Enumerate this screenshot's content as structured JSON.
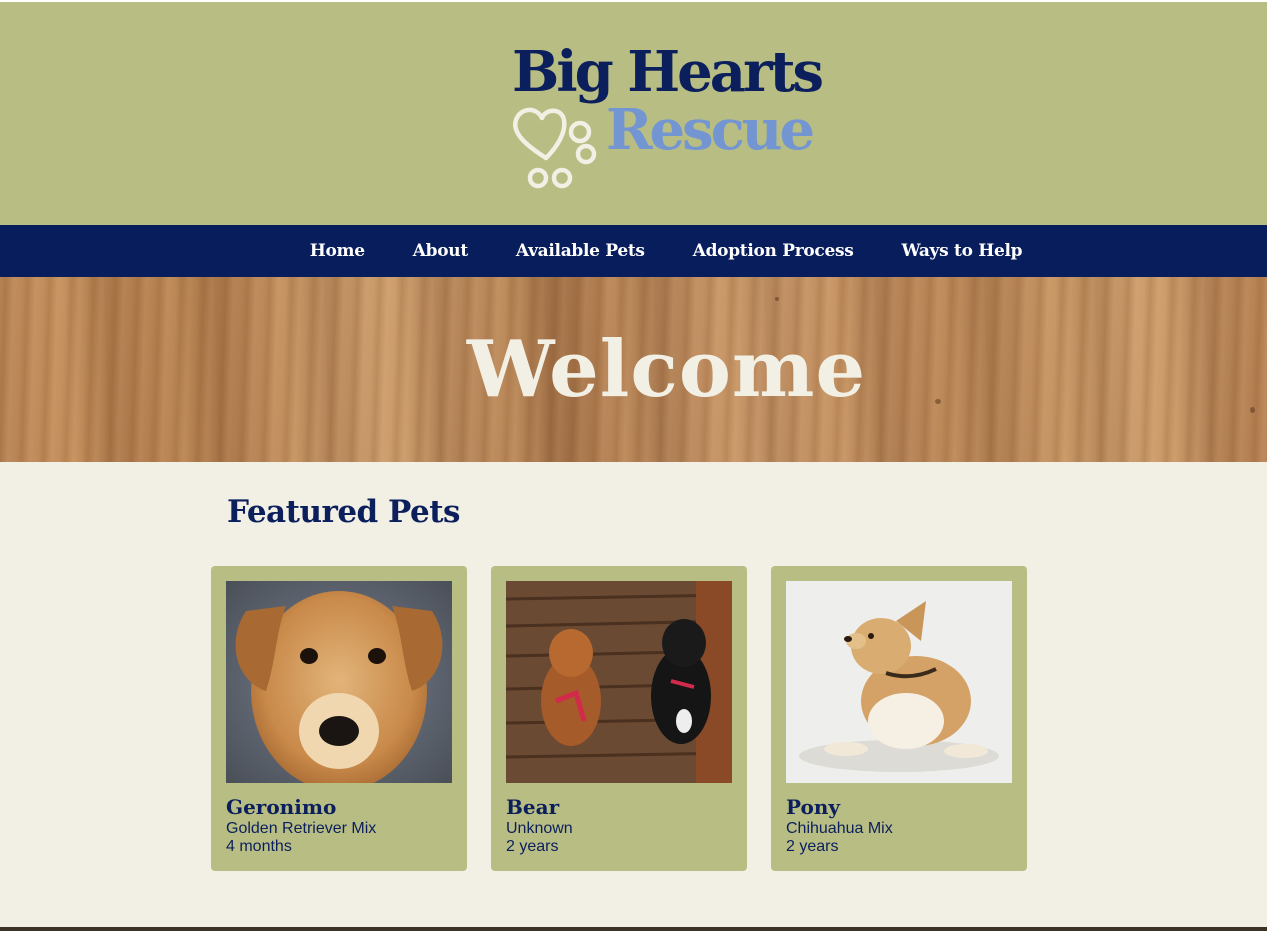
{
  "brand": {
    "line1": "Big Hearts",
    "line2": "Rescue"
  },
  "nav": {
    "items": [
      "Home",
      "About",
      "Available Pets",
      "Adoption Process",
      "Ways to Help"
    ]
  },
  "hero": {
    "title": "Welcome"
  },
  "featured": {
    "heading": "Featured Pets",
    "pets": [
      {
        "name": "Geronimo",
        "breed": "Golden Retriever Mix",
        "age": "4 months"
      },
      {
        "name": "Bear",
        "breed": "Unknown",
        "age": "2 years"
      },
      {
        "name": "Pony",
        "breed": "Chihuahua Mix",
        "age": "2 years"
      }
    ]
  },
  "colors": {
    "header_bg": "#b8bd84",
    "nav_bg": "#081d5c",
    "brand_dark": "#0b1f5c",
    "brand_light": "#7395d2",
    "page_bg": "#f2efe4"
  },
  "icons": {
    "logo_mark": "heart-paw-icon"
  }
}
